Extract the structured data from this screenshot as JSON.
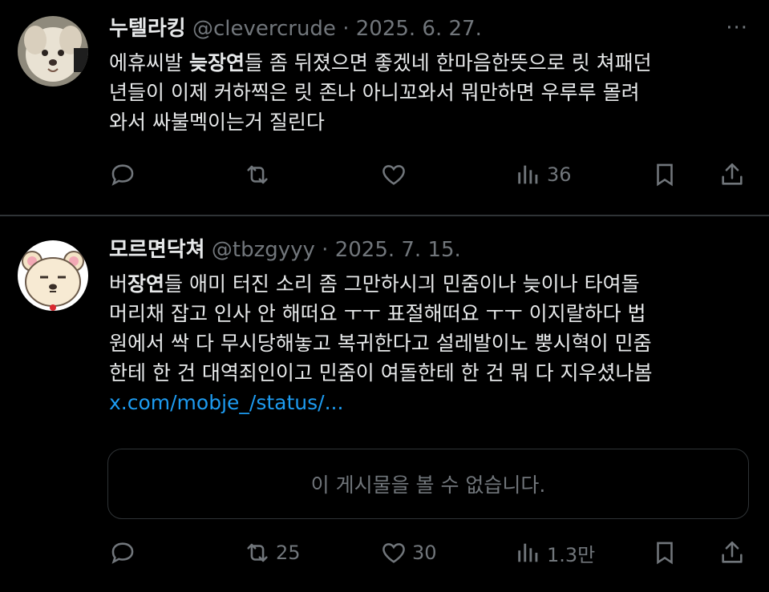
{
  "tweets": [
    {
      "display_name": "누텔라킹",
      "handle": "@clevercrude",
      "date": "2025. 6. 27.",
      "more": "···",
      "lines": [
        {
          "pre": "에휴씨발 ",
          "bold": "늦장연",
          "post": "들 좀 뒤졌으면 좋겠네 한마음한뜻으로 릿 쳐패던"
        },
        {
          "pre": "년들이 이제 커하찍은 릿 존나 아니꼬와서 뭐만하면 우루루 몰려",
          "bold": "",
          "post": ""
        },
        {
          "pre": "와서 싸불멕이는거 질린다",
          "bold": "",
          "post": ""
        }
      ],
      "stats": {
        "replies": "",
        "retweets": "",
        "likes": "",
        "views": "36"
      }
    },
    {
      "display_name": "모르면닥쳐",
      "handle": "@tbzgyyy",
      "date": "2025. 7. 15.",
      "lines": [
        {
          "pre": "버",
          "bold": "장연",
          "post": "들 애미 터진 소리 좀 그만하시긔 민줌이나 늦이나 타여돌"
        },
        {
          "pre": "머리채 잡고 인사 안 해떠요 ㅜㅜ 표절해떠요 ㅜㅜ 이지랄하다 법",
          "bold": "",
          "post": ""
        },
        {
          "pre": "원에서 싹 다 무시당해놓고 복귀한다고 설레발이노 뿡시혁이 민줌",
          "bold": "",
          "post": ""
        },
        {
          "pre": "한테 한 건 대역죄인이고 민줌이 여돌한테 한 건 뭐 다 지우셨나봄",
          "bold": "",
          "post": ""
        }
      ],
      "link": "x.com/mobje_/status/...",
      "unavailable": "이 게시물을 볼 수 없습니다.",
      "stats": {
        "replies": "",
        "retweets": "25",
        "likes": "30",
        "views": "1.3만"
      }
    }
  ],
  "icons": {
    "reply": "reply-icon",
    "retweet": "retweet-icon",
    "like": "heart-icon",
    "views": "views-icon",
    "bookmark": "bookmark-icon",
    "share": "share-icon"
  },
  "colors": {
    "background": "#000000",
    "text": "#e7e9ea",
    "muted": "#71767b",
    "link": "#1d9bf0",
    "divider": "#2f3336"
  }
}
